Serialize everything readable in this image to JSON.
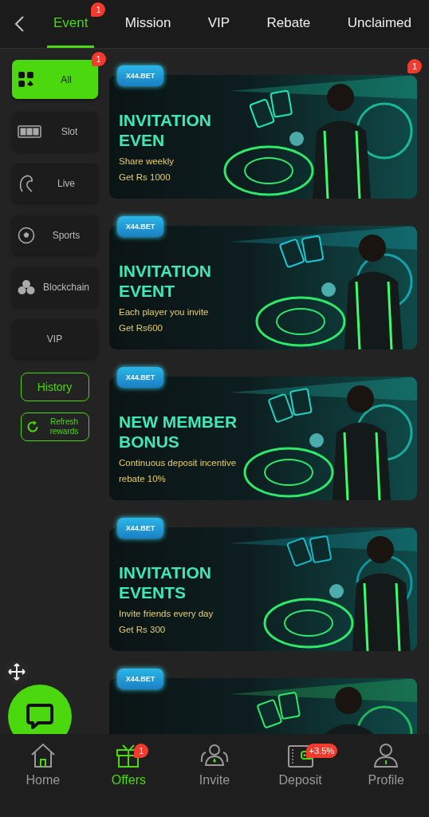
{
  "tabs": [
    {
      "label": "Event",
      "selected": true,
      "badge": "1"
    },
    {
      "label": "Mission",
      "selected": false
    },
    {
      "label": "VIP",
      "selected": false
    },
    {
      "label": "Rebate",
      "selected": false
    },
    {
      "label": "Unclaimed",
      "selected": false
    }
  ],
  "sidebar": {
    "items": [
      {
        "label": "All",
        "kind": "grid",
        "selected": true,
        "badge": "1"
      },
      {
        "label": "Slot",
        "kind": "slot",
        "selected": false
      },
      {
        "label": "Live",
        "kind": "live",
        "selected": false
      },
      {
        "label": "Sports",
        "kind": "sports",
        "selected": false
      },
      {
        "label": "Blockchain",
        "kind": "blockchain",
        "selected": false
      },
      {
        "label": "VIP",
        "kind": "plain",
        "selected": false
      }
    ],
    "history": "History",
    "refresh": "Refresh rewards"
  },
  "banners": [
    {
      "brand": "X44.BET",
      "title": "INVITATION EVEN",
      "lines": [
        "Share weekly",
        "Get Rs 1000"
      ],
      "badge": "1"
    },
    {
      "brand": "X44.BET",
      "title": "INVITATION EVENT",
      "lines": [
        "Each player you invite",
        "Get Rs600"
      ]
    },
    {
      "brand": "X44.BET",
      "title": "NEW MEMBER BONUS",
      "lines": [
        "Continuous deposit incentive",
        "rebate 10%"
      ]
    },
    {
      "brand": "X44.BET",
      "title": "INVITATION EVENTS",
      "lines": [
        "Invite friends every day",
        "Get Rs 300"
      ]
    },
    {
      "brand": "X44.BET"
    }
  ],
  "nav": {
    "items": [
      {
        "label": "Home",
        "kind": "home",
        "selected": false
      },
      {
        "label": "Offers",
        "kind": "gift",
        "selected": true,
        "badge": "1"
      },
      {
        "label": "Invite",
        "kind": "people",
        "selected": false
      },
      {
        "label": "Deposit",
        "kind": "wallet",
        "selected": false,
        "badge": "+3.5%"
      },
      {
        "label": "Profile",
        "kind": "person",
        "selected": false
      }
    ]
  }
}
